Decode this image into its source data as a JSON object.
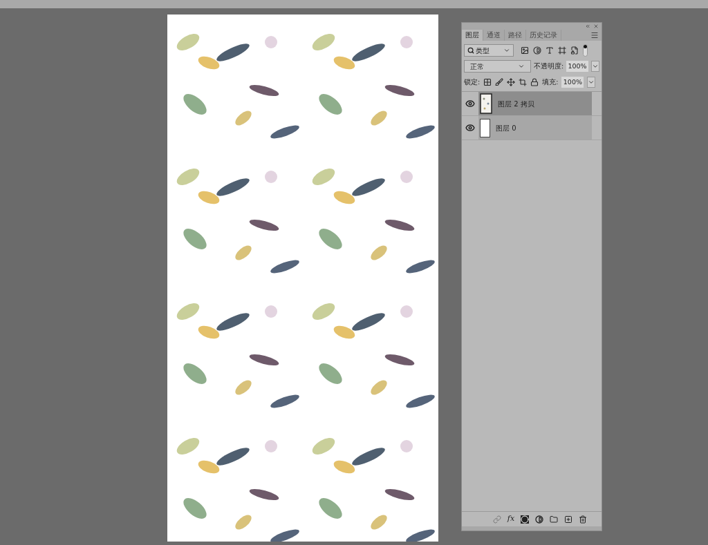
{
  "layers_panel": {
    "tabs": [
      {
        "label": "图层",
        "selected": true
      },
      {
        "label": "通道",
        "selected": false
      },
      {
        "label": "路径",
        "selected": false
      },
      {
        "label": "历史记录",
        "selected": false
      }
    ],
    "filter": {
      "value": "类型"
    },
    "blend_mode": {
      "value": "正常"
    },
    "opacity": {
      "label": "不透明度:",
      "value": "100%"
    },
    "lock": {
      "label": "锁定:"
    },
    "fill": {
      "label": "填充:",
      "value": "100%"
    },
    "layers": [
      {
        "name": "图层 2 拷贝",
        "visible": true,
        "selected": true,
        "kind": "pattern"
      },
      {
        "name": "图层 0",
        "visible": true,
        "selected": false,
        "kind": "blank"
      }
    ],
    "footer": {
      "fx": "fx"
    }
  }
}
